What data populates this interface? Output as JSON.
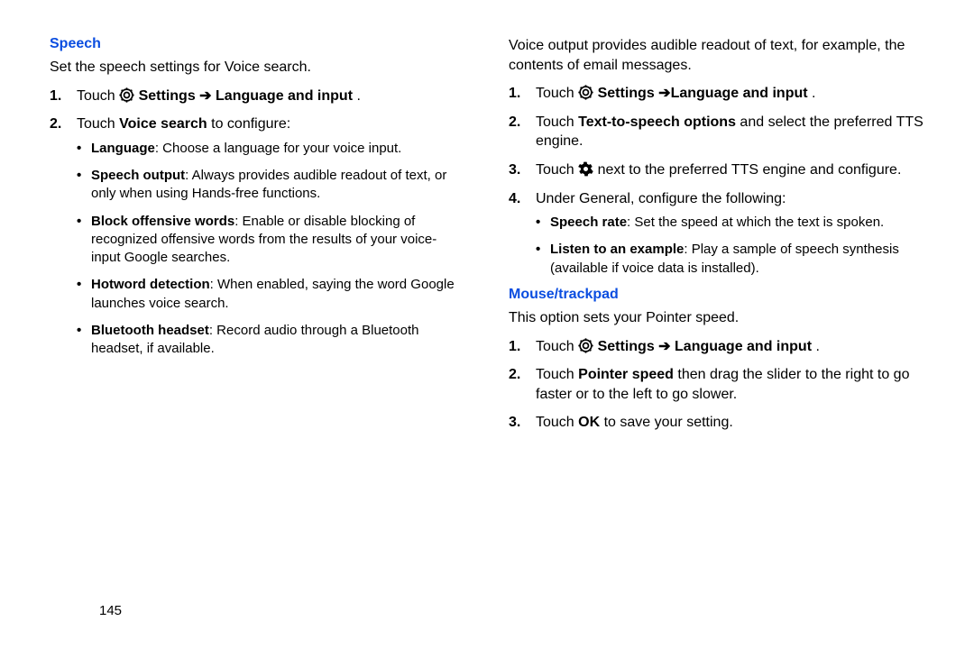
{
  "page_number": "145",
  "left": {
    "heading": "Speech",
    "intro": "Set the speech settings for Voice search.",
    "step1": {
      "touch": "Touch ",
      "settings": " Settings",
      "arrow": " ➔ Language and input",
      "end": "."
    },
    "step2": {
      "touch": "Touch ",
      "bold": "Voice search",
      "rest": " to configure:"
    },
    "bullets": [
      {
        "bold": "Language",
        "rest": ": Choose a language for your voice input."
      },
      {
        "bold": "Speech output",
        "rest": ": Always provides audible readout of text, or only when using Hands-free functions."
      },
      {
        "bold": "Block offensive words",
        "rest": ": Enable or disable blocking of recognized offensive words from the results of your voice-input Google searches."
      },
      {
        "bold": "Hotword detection",
        "rest": ": When enabled, saying the word Google launches voice search."
      },
      {
        "bold": "Bluetooth headset",
        "rest": ": Record audio through a Bluetooth headset, if available."
      }
    ]
  },
  "right": {
    "intro_top": "Voice output provides audible readout of text, for example, the contents of email messages.",
    "g1": {
      "step1": {
        "touch": "Touch ",
        "settings": " Settings",
        "arrow": " ➔Language and input",
        "end": "."
      },
      "step2": {
        "touch": "Touch ",
        "bold": "Text-to-speech options",
        "rest": " and select the preferred TTS engine."
      },
      "step3": {
        "touch": "Touch ",
        "rest": " next to the preferred TTS engine and configure."
      },
      "step4": {
        "text": "Under General, configure the following:"
      },
      "bullets": [
        {
          "bold": "Speech rate",
          "rest": ": Set the speed at which the text is spoken."
        },
        {
          "bold": "Listen to an example",
          "rest": ": Play a sample of speech synthesis (available if voice data is installed)."
        }
      ]
    },
    "heading2": "Mouse/trackpad",
    "intro2": "This option sets your Pointer speed.",
    "g2": {
      "step1": {
        "touch": "Touch ",
        "settings": " Settings",
        "arrow": " ➔ Language and input",
        "end": "."
      },
      "step2": {
        "touch": "Touch ",
        "bold": "Pointer speed",
        "rest": " then drag the slider to the right to go faster or to the left to go slower."
      },
      "step3": {
        "touch": "Touch ",
        "bold": "OK",
        "rest": " to save your setting."
      }
    }
  }
}
